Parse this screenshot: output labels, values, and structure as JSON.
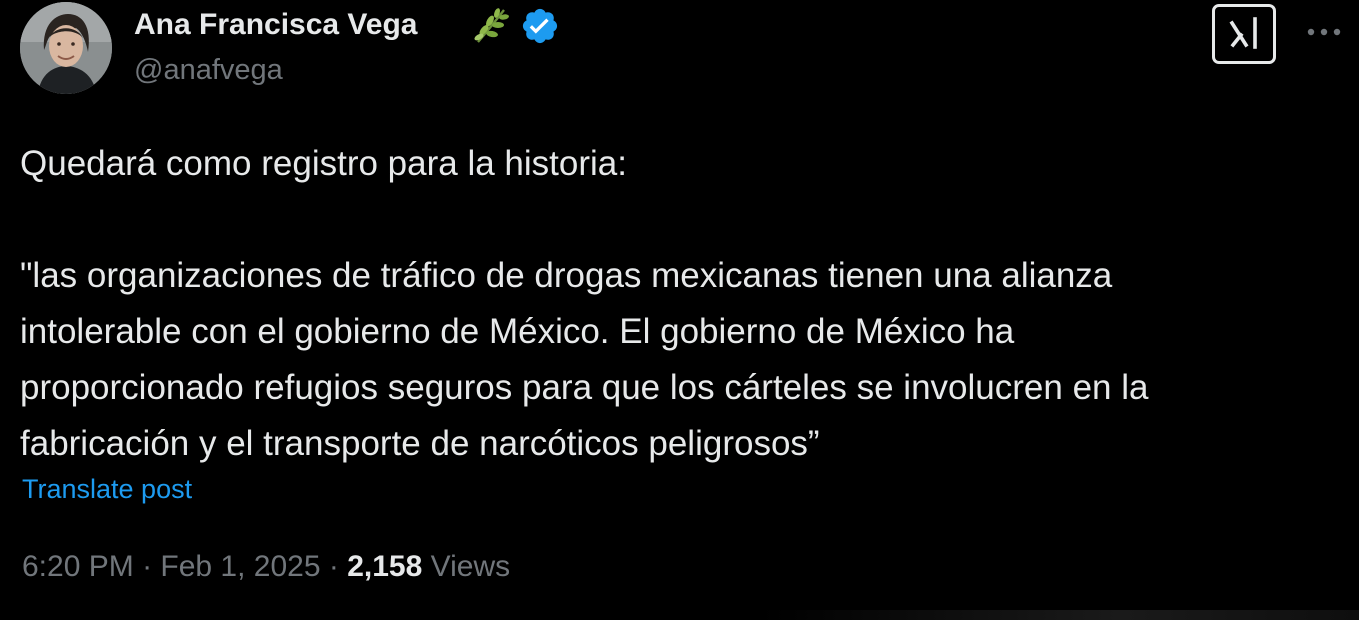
{
  "author": {
    "name": "Ana Francisca Vega",
    "handle": "@anafvega",
    "emoji_icon": "herb-icon",
    "verified_icon": "verified-badge-icon"
  },
  "tweet": {
    "lines": [
      "Quedará como registro para la historia:",
      "",
      "\"las organizaciones de tráfico de drogas mexicanas tienen una alianza",
      "intolerable con el gobierno de México. El gobierno de México ha",
      "proporcionado refugios seguros para que los cárteles se involucren en la",
      "fabricación y el transporte de narcóticos peligrosos”"
    ],
    "translate_label": "Translate post"
  },
  "meta": {
    "time": "6:20 PM",
    "separator": " · ",
    "date": "Feb 1, 2025",
    "views_count": "2,158",
    "views_label": "Views"
  },
  "icons": {
    "grok": "grok-icon",
    "more": "more-options-icon"
  },
  "colors": {
    "background": "#000000",
    "text": "#e7e9ea",
    "secondary": "#71767b",
    "accent": "#1d9bf0",
    "verified": "#1d9bf0"
  }
}
